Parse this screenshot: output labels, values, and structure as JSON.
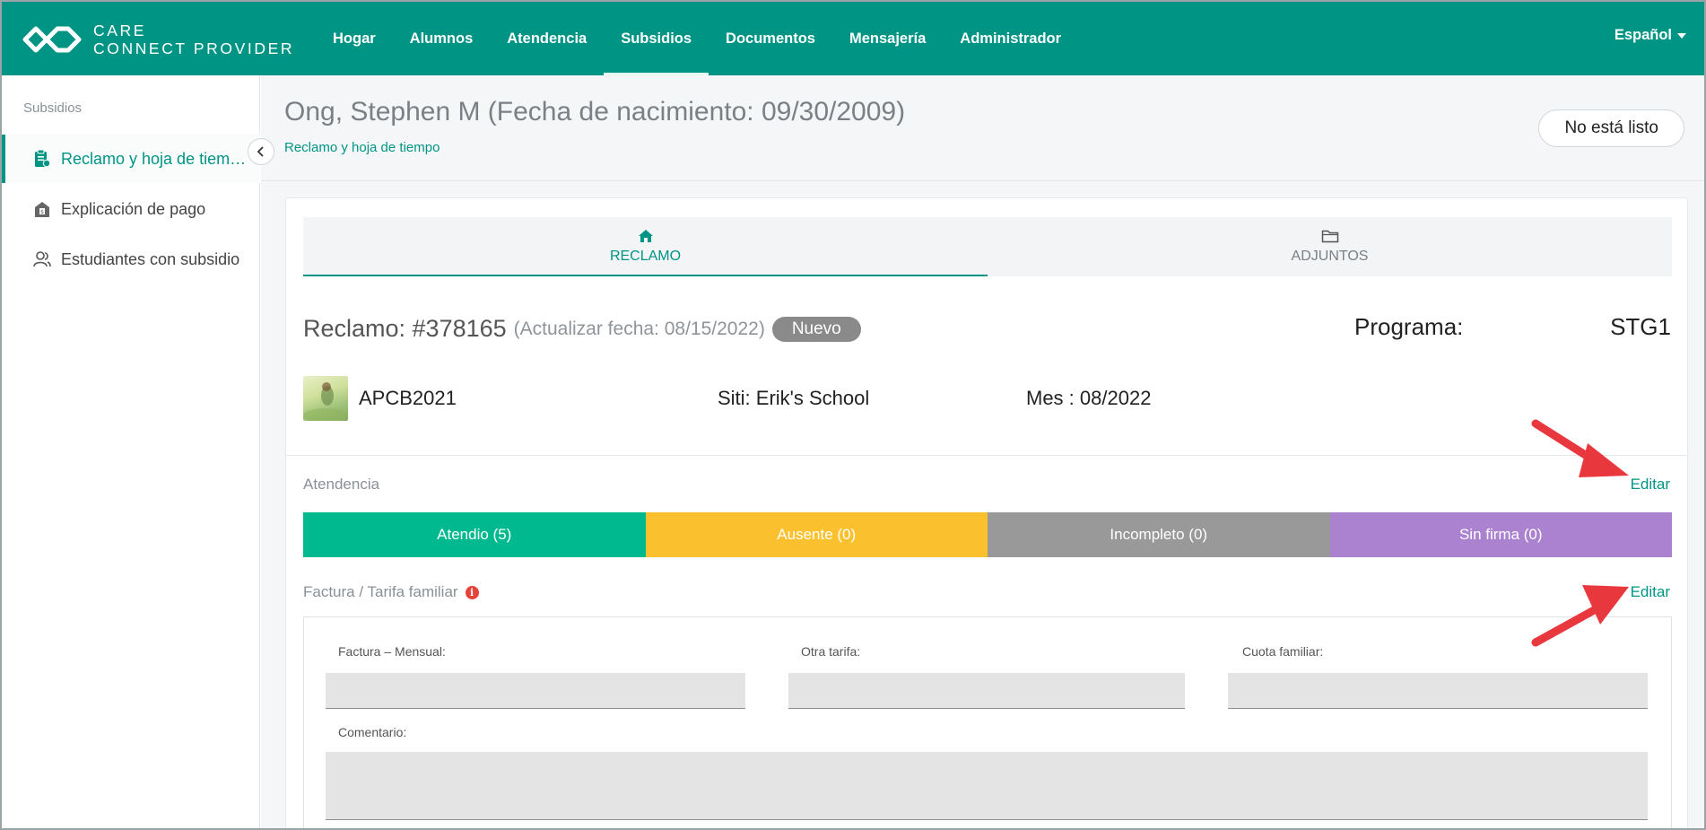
{
  "brand": {
    "line1": "CARE",
    "line2": "CONNECT PROVIDER"
  },
  "nav": {
    "items": [
      {
        "label": "Hogar"
      },
      {
        "label": "Alumnos"
      },
      {
        "label": "Atendencia"
      },
      {
        "label": "Subsidios",
        "active": true
      },
      {
        "label": "Documentos"
      },
      {
        "label": "Mensajería"
      },
      {
        "label": "Administrador"
      }
    ],
    "language": "Español"
  },
  "sidebar": {
    "heading": "Subsidios",
    "items": [
      {
        "label": "Reclamo y hoja de tiem…",
        "icon": "clipboard-icon",
        "active": true
      },
      {
        "label": "Explicación de pago",
        "icon": "payment-building-icon"
      },
      {
        "label": "Estudiantes con subsidio",
        "icon": "students-icon"
      }
    ]
  },
  "header": {
    "title": "Ong, Stephen M (Fecha de nacimiento: 09/30/2009)",
    "breadcrumb": "Reclamo y hoja de tiempo",
    "status_button": "No está listo"
  },
  "tabs": [
    {
      "label": "RECLAMO",
      "icon": "home-icon",
      "active": true
    },
    {
      "label": "ADJUNTOS",
      "icon": "folder-icon"
    }
  ],
  "claim": {
    "title": "Reclamo: #378165",
    "update_date": "(Actualizar fecha: 08/15/2022)",
    "badge": "Nuevo",
    "program_label": "Programa:",
    "program_value": "STG1",
    "provider_code": "APCB2021",
    "site": "Siti: Erik's School",
    "month": "Mes : 08/2022"
  },
  "attendance": {
    "label": "Atendencia",
    "edit": "Editar",
    "segments": [
      {
        "label": "Atendio (5)",
        "color": "#00b98e"
      },
      {
        "label": "Ausente (0)",
        "color": "#fbc02d"
      },
      {
        "label": "Incompleto (0)",
        "color": "#999999"
      },
      {
        "label": "Sin firma (0)",
        "color": "#ab82cf"
      }
    ]
  },
  "invoice": {
    "label": "Factura / Tarifa familiar",
    "edit": "Editar",
    "fields": {
      "monthly_label": "Factura – Mensual:",
      "monthly_value": "",
      "other_label": "Otra tarifa:",
      "other_value": "",
      "family_label": "Cuota familiar:",
      "family_value": "",
      "comment_label": "Comentario:",
      "comment_value": ""
    }
  },
  "colors": {
    "brand": "#009485",
    "annotation_arrow": "#e8383d"
  }
}
